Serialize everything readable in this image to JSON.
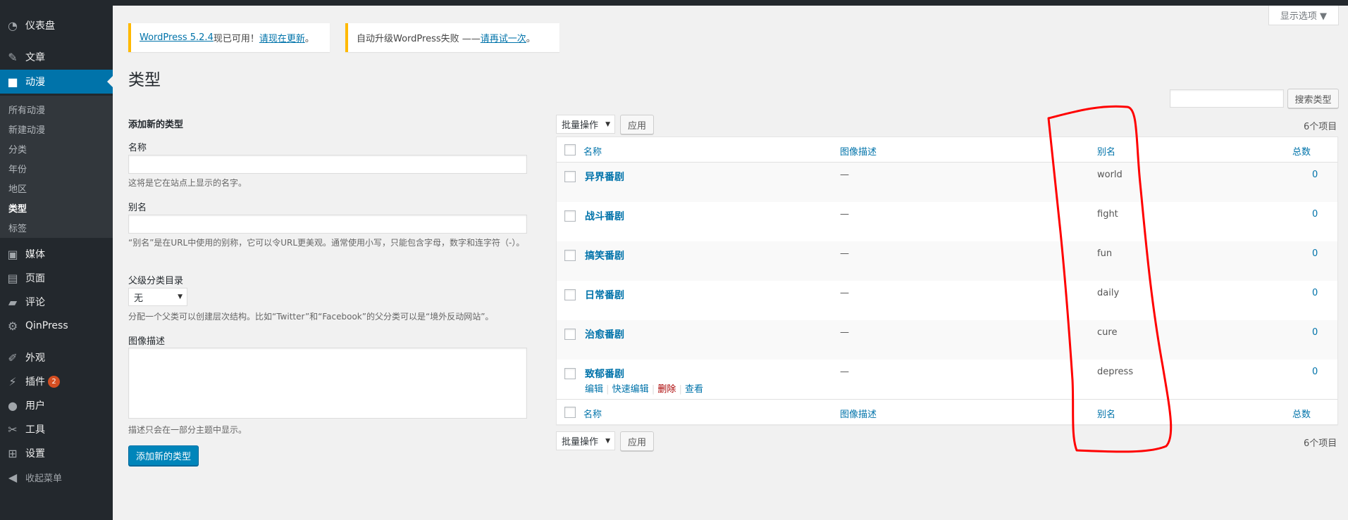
{
  "sidebar": {
    "items_top": [
      {
        "icon": "dashboard-icon",
        "label": "仪表盘"
      },
      {
        "icon": "pin-icon",
        "label": "文章"
      },
      {
        "icon": "video-icon",
        "label": "动漫"
      }
    ],
    "submenu": [
      "所有动漫",
      "新建动漫",
      "分类",
      "年份",
      "地区",
      "类型",
      "标签"
    ],
    "items_bottom": [
      {
        "icon": "media-icon",
        "label": "媒体"
      },
      {
        "icon": "page-icon",
        "label": "页面"
      },
      {
        "icon": "comment-icon",
        "label": "评论"
      },
      {
        "icon": "gear-icon",
        "label": "QinPress"
      },
      {
        "icon": "brush-icon",
        "label": "外观"
      },
      {
        "icon": "plugin-icon",
        "label": "插件",
        "badge": "2"
      },
      {
        "icon": "user-icon",
        "label": "用户"
      },
      {
        "icon": "wrench-icon",
        "label": "工具"
      },
      {
        "icon": "settings-icon",
        "label": "设置"
      }
    ],
    "collapse_label": "收起菜单"
  },
  "notices": {
    "update": {
      "link": "WordPress 5.2.4",
      "text": "现已可用！",
      "action": "请现在更新",
      "end": "。"
    },
    "autoupdate": {
      "text": "自动升级WordPress失败 —— ",
      "action": "请再试一次",
      "end": "。"
    }
  },
  "screen_options_label": "显示选项 ▼",
  "page_title": "类型",
  "search": {
    "button_label": "搜索类型",
    "value": ""
  },
  "form": {
    "title": "添加新的类型",
    "name_label": "名称",
    "name_desc": "这将是它在站点上显示的名字。",
    "slug_label": "别名",
    "slug_desc": "“别名”是在URL中使用的别称，它可以令URL更美观。通常使用小写，只能包含字母，数字和连字符（-）。",
    "parent_label": "父级分类目录",
    "parent_value": "无",
    "parent_desc": "分配一个父类可以创建层次结构。比如“Twitter”和“Facebook”的父分类可以是“境外反动网站”。",
    "image_desc_label": "图像描述",
    "image_desc_help": "描述只会在一部分主题中显示。",
    "submit_label": "添加新的类型"
  },
  "bulk": {
    "select_label": "批量操作",
    "apply_label": "应用",
    "items_count": "6个项目"
  },
  "table": {
    "columns": [
      "名称",
      "图像描述",
      "别名",
      "总数"
    ],
    "rows": [
      {
        "name": "异界番剧",
        "desc": "—",
        "slug": "world",
        "count": "0"
      },
      {
        "name": "战斗番剧",
        "desc": "—",
        "slug": "fight",
        "count": "0"
      },
      {
        "name": "搞笑番剧",
        "desc": "—",
        "slug": "fun",
        "count": "0"
      },
      {
        "name": "日常番剧",
        "desc": "—",
        "slug": "daily",
        "count": "0"
      },
      {
        "name": "治愈番剧",
        "desc": "—",
        "slug": "cure",
        "count": "0"
      },
      {
        "name": "致郁番剧",
        "desc": "—",
        "slug": "depress",
        "count": "0"
      }
    ],
    "row_actions": {
      "edit": "编辑",
      "quick_edit": "快速编辑",
      "delete": "删除",
      "view": "查看"
    }
  },
  "colors": {
    "sidebar_bg": "#23282d",
    "accent": "#0073aa",
    "notice_border": "#ffb900",
    "annotation": "#ff0000"
  }
}
